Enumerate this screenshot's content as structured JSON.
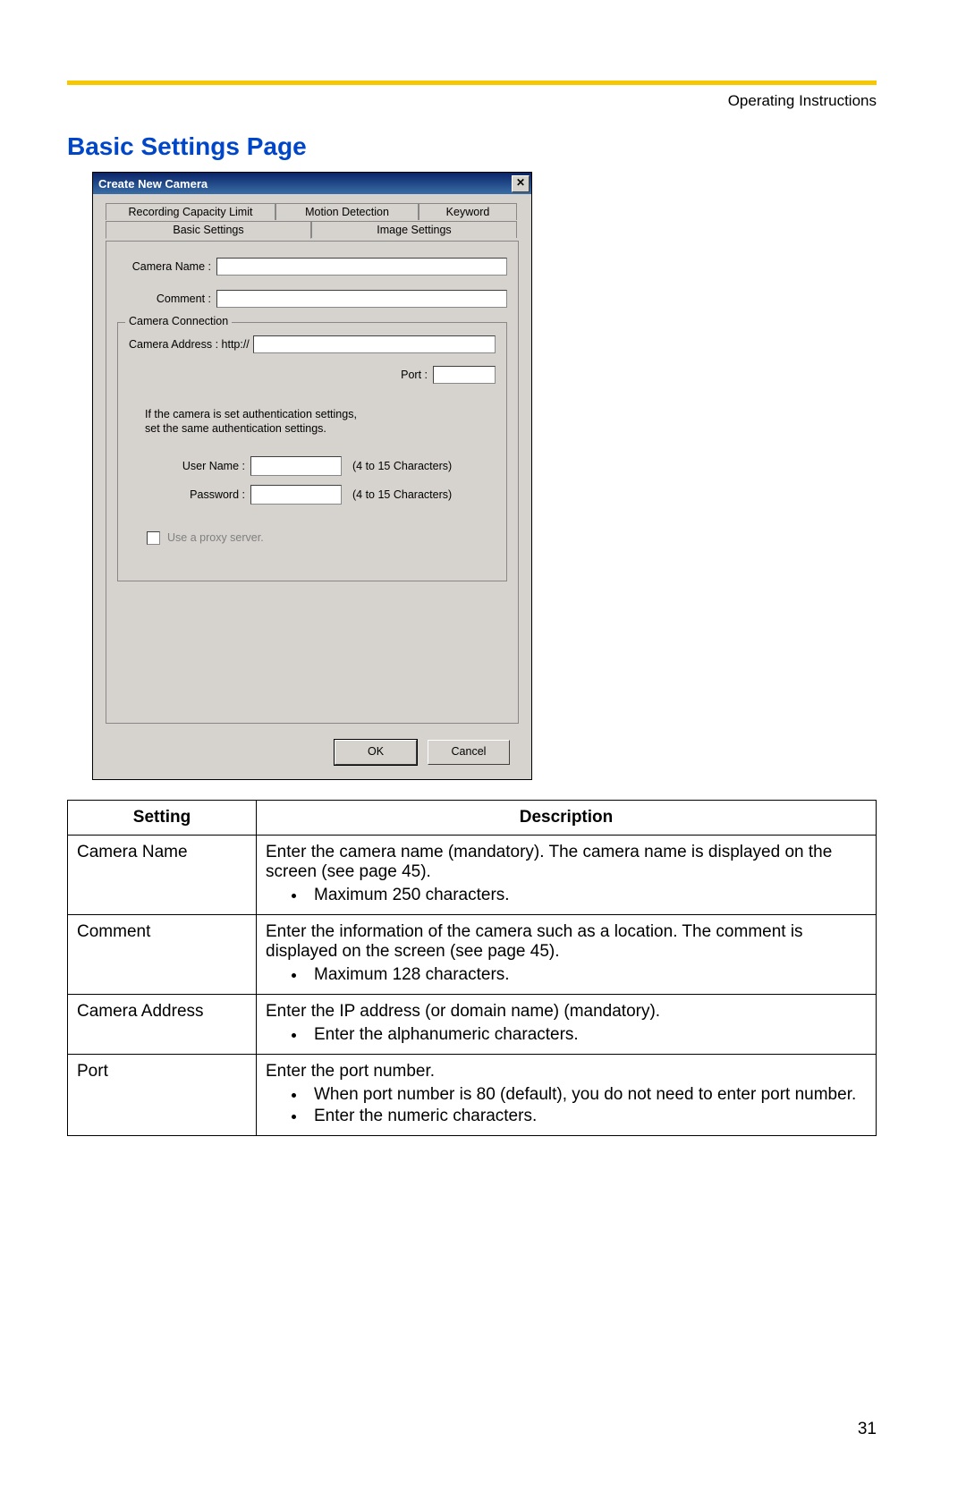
{
  "header": {
    "doc_title": "Operating Instructions"
  },
  "section_title": "Basic Settings Page",
  "dialog": {
    "title": "Create New Camera",
    "close_glyph": "✕",
    "tabs": {
      "recording_capacity": "Recording Capacity Limit",
      "motion_detection": "Motion Detection",
      "keyword": "Keyword",
      "basic_settings": "Basic Settings",
      "image_settings": "Image Settings"
    },
    "fields": {
      "camera_name_label": "Camera Name :",
      "comment_label": "Comment :",
      "connection_legend": "Camera Connection",
      "camera_address_label": "Camera Address : http://",
      "port_label": "Port :",
      "auth_text1": "If the camera is set authentication settings,",
      "auth_text2": "set the same authentication settings.",
      "username_label": "User Name :",
      "password_label": "Password :",
      "char_hint": "(4 to 15 Characters)",
      "proxy_label": "Use a proxy server."
    },
    "buttons": {
      "ok": "OK",
      "cancel": "Cancel"
    }
  },
  "table": {
    "col1_header": "Setting",
    "col2_header": "Description",
    "rows": [
      {
        "setting": "Camera Name",
        "desc_text": "Enter the camera name (mandatory). The camera name is displayed on the screen (see page 45).",
        "bullets": [
          "Maximum 250 characters."
        ]
      },
      {
        "setting": "Comment",
        "desc_text": "Enter the information of the camera such as a location. The comment is displayed on the screen (see page 45).",
        "bullets": [
          "Maximum 128 characters."
        ]
      },
      {
        "setting": "Camera Address",
        "desc_text": "Enter the IP address (or domain name) (mandatory).",
        "bullets": [
          "Enter the alphanumeric characters."
        ]
      },
      {
        "setting": "Port",
        "desc_text": "Enter the port number.",
        "bullets": [
          "When port number is 80 (default), you do not need to enter port number.",
          "Enter the numeric characters."
        ]
      }
    ]
  },
  "page_number": "31"
}
